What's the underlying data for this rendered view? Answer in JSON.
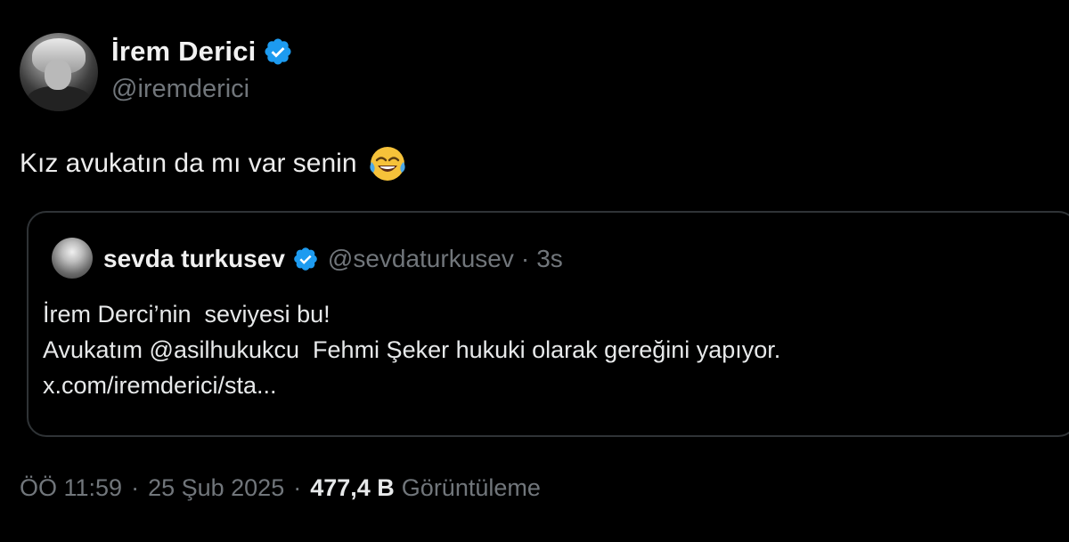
{
  "tweet": {
    "author": {
      "display_name": "İrem Derici",
      "handle": "@iremderici",
      "verified": true
    },
    "text": "Kız avukatın da mı var senin",
    "emoji": "face-with-tears-of-joy",
    "quoted": {
      "author": {
        "display_name": "sevda turkusev",
        "handle": "@sevdaturkusev",
        "verified": true
      },
      "dot": "·",
      "time": "3s",
      "lines": [
        "İrem Derci’nin  seviyesi bu!",
        "Avukatım @asilhukukcu  Fehmi Şeker hukuki olarak gereğini yapıyor.",
        "x.com/iremderici/sta..."
      ]
    },
    "meta": {
      "time": "ÖÖ 11:59",
      "sep1": "·",
      "date": "25 Şub 2025",
      "sep2": "·",
      "views_count": "477,4 B",
      "views_label": "Görüntüleme"
    }
  },
  "colors": {
    "background": "#000000",
    "text_primary": "#e7e9ea",
    "text_secondary": "#71767b",
    "border": "#2f3336",
    "verified_blue": "#1d9bf0"
  }
}
